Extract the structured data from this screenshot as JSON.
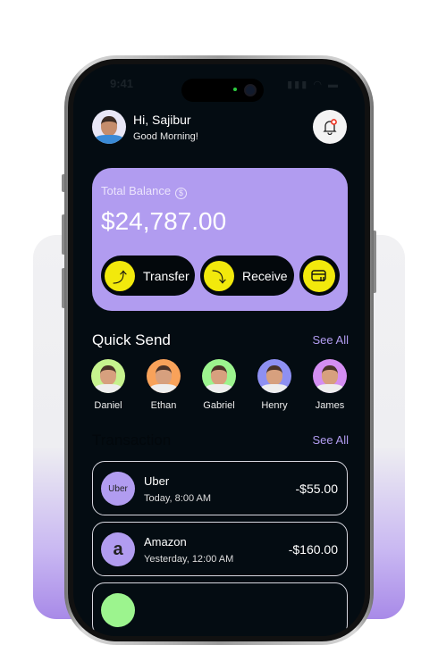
{
  "status_bar": {
    "time": "9:41"
  },
  "header": {
    "greeting": "Hi, Sajibur",
    "subtitle": "Good Morning!"
  },
  "balance": {
    "label": "Total Balance",
    "currency_icon": "$",
    "amount": "$24,787.00",
    "transfer_label": "Transfer",
    "receive_label": "Receive"
  },
  "quick_send": {
    "title": "Quick Send",
    "see_all": "See All",
    "contacts": [
      {
        "name": "Daniel",
        "color": "#c6f28e"
      },
      {
        "name": "Ethan",
        "color": "#f8a25a"
      },
      {
        "name": "Gabriel",
        "color": "#9cf48e"
      },
      {
        "name": "Henry",
        "color": "#8e90f2"
      },
      {
        "name": "James",
        "color": "#d48ef2"
      }
    ]
  },
  "transactions": {
    "title": "Transaction",
    "see_all": "See All",
    "items": [
      {
        "name": "Uber",
        "logo": "Uber",
        "date": "Today, 8:00 AM",
        "amount": "-$55.00"
      },
      {
        "name": "Amazon",
        "logo": "a",
        "date": "Yesterday, 12:00 AM",
        "amount": "-$160.00"
      }
    ]
  },
  "colors": {
    "accent": "#b19cf0",
    "yellow": "#f2e90c",
    "background": "#040c12"
  }
}
